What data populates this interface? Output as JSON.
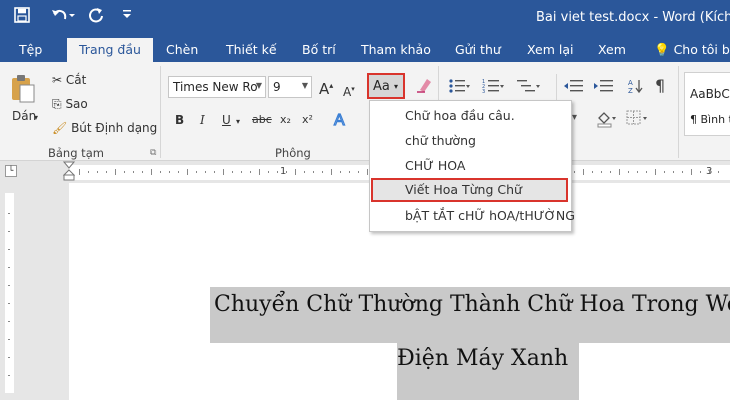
{
  "title_bar": {
    "title": "Bai viet test.docx - Word (Kích hoạt",
    "quick_access": [
      {
        "icon": "save-icon",
        "glyph": "💾"
      },
      {
        "icon": "undo-icon",
        "glyph": "↶▾"
      },
      {
        "icon": "redo-icon",
        "glyph": "↻"
      },
      {
        "icon": "customize-icon",
        "glyph": "⊽"
      }
    ]
  },
  "tabs": [
    "Tệp",
    "Trang đầu",
    "Chèn",
    "Thiết kế",
    "Bố trí",
    "Tham khảo",
    "Gửi thư",
    "Xem lại",
    "Xem"
  ],
  "tell_me": {
    "icon": "lightbulb-icon",
    "label": "Cho tôi bi"
  },
  "clipboard": {
    "paste_label": "Dán",
    "cut_label": "Cắt",
    "copy_label": "Sao",
    "format_painter_label": "Bút Định dạng",
    "group_label": "Bảng tạm"
  },
  "font": {
    "font_name": "Times New Ro",
    "font_size": "9",
    "grow_label": "A",
    "shrink_label": "A",
    "change_case_label": "Aa",
    "bold": "B",
    "italic": "I",
    "underline": "U",
    "strike": "abc",
    "subscript": "x₂",
    "superscript": "x²",
    "group_label": "Phông"
  },
  "styles": {
    "preview": "AaBbC",
    "name": "¶ Bình t"
  },
  "change_case_menu": {
    "items": [
      {
        "label": "Chữ hoa đầu câu."
      },
      {
        "label": "chữ thường"
      },
      {
        "label": "CHỮ HOA"
      },
      {
        "label": "Viết Hoa Từng Chữ",
        "highlighted": true
      },
      {
        "label": "bẬT tẮT cHỮ hOA/tHƯỜNG"
      }
    ]
  },
  "ruler": {
    "numbers": [
      "1",
      "3"
    ]
  },
  "document": {
    "line1": "Chuyển Chữ Thường Thành Chữ Hoa Trong Wo",
    "line2": "Điện Máy Xanh"
  },
  "colors": {
    "brand": "#2b579a",
    "highlight_border": "#d9342c"
  }
}
